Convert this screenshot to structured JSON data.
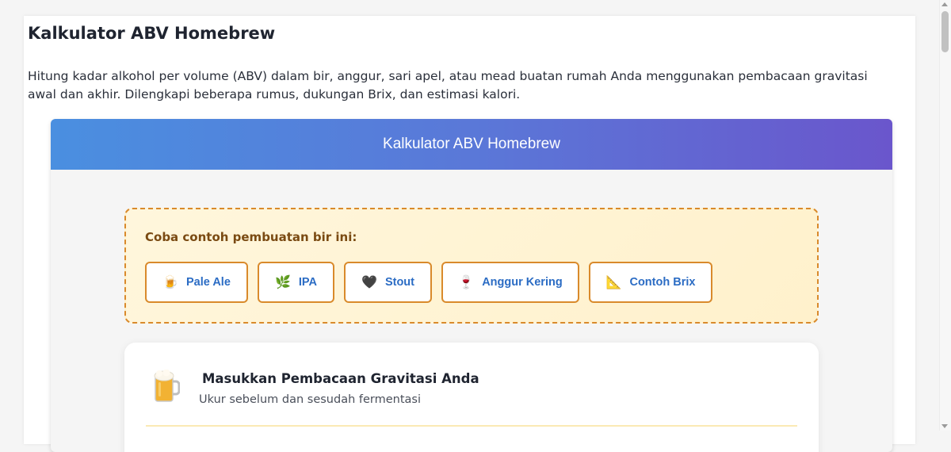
{
  "page": {
    "title": "Kalkulator ABV Homebrew",
    "description": "Hitung kadar alkohol per volume (ABV) dalam bir, anggur, sari apel, atau mead buatan rumah Anda menggunakan pembacaan gravitasi awal dan akhir. Dilengkapi beberapa rumus, dukungan Brix, dan estimasi kalori."
  },
  "calculator": {
    "header": "Kalkulator ABV Homebrew",
    "header_gradient": [
      "#4a8fe0",
      "#6a56cc"
    ]
  },
  "examples": {
    "title": "Coba contoh pembuatan bir ini:",
    "buttons": [
      {
        "icon": "🍺",
        "icon_name": "beer-mug-icon",
        "label": "Pale Ale"
      },
      {
        "icon": "🌿",
        "icon_name": "herb-icon",
        "label": "IPA"
      },
      {
        "icon": "🖤",
        "icon_name": "black-heart-icon",
        "label": "Stout"
      },
      {
        "icon": "🍷",
        "icon_name": "wine-glass-icon",
        "label": "Anggur Kering"
      },
      {
        "icon": "📐",
        "icon_name": "triangular-ruler-icon",
        "label": "Contoh Brix"
      }
    ],
    "accent_color": "#d98a2b",
    "link_color": "#2b6cc4"
  },
  "gravity": {
    "icon_name": "beer-mug-icon",
    "title": "Masukkan Pembacaan Gravitasi Anda",
    "subtitle": "Ukur sebelum dan sesudah fermentasi"
  }
}
